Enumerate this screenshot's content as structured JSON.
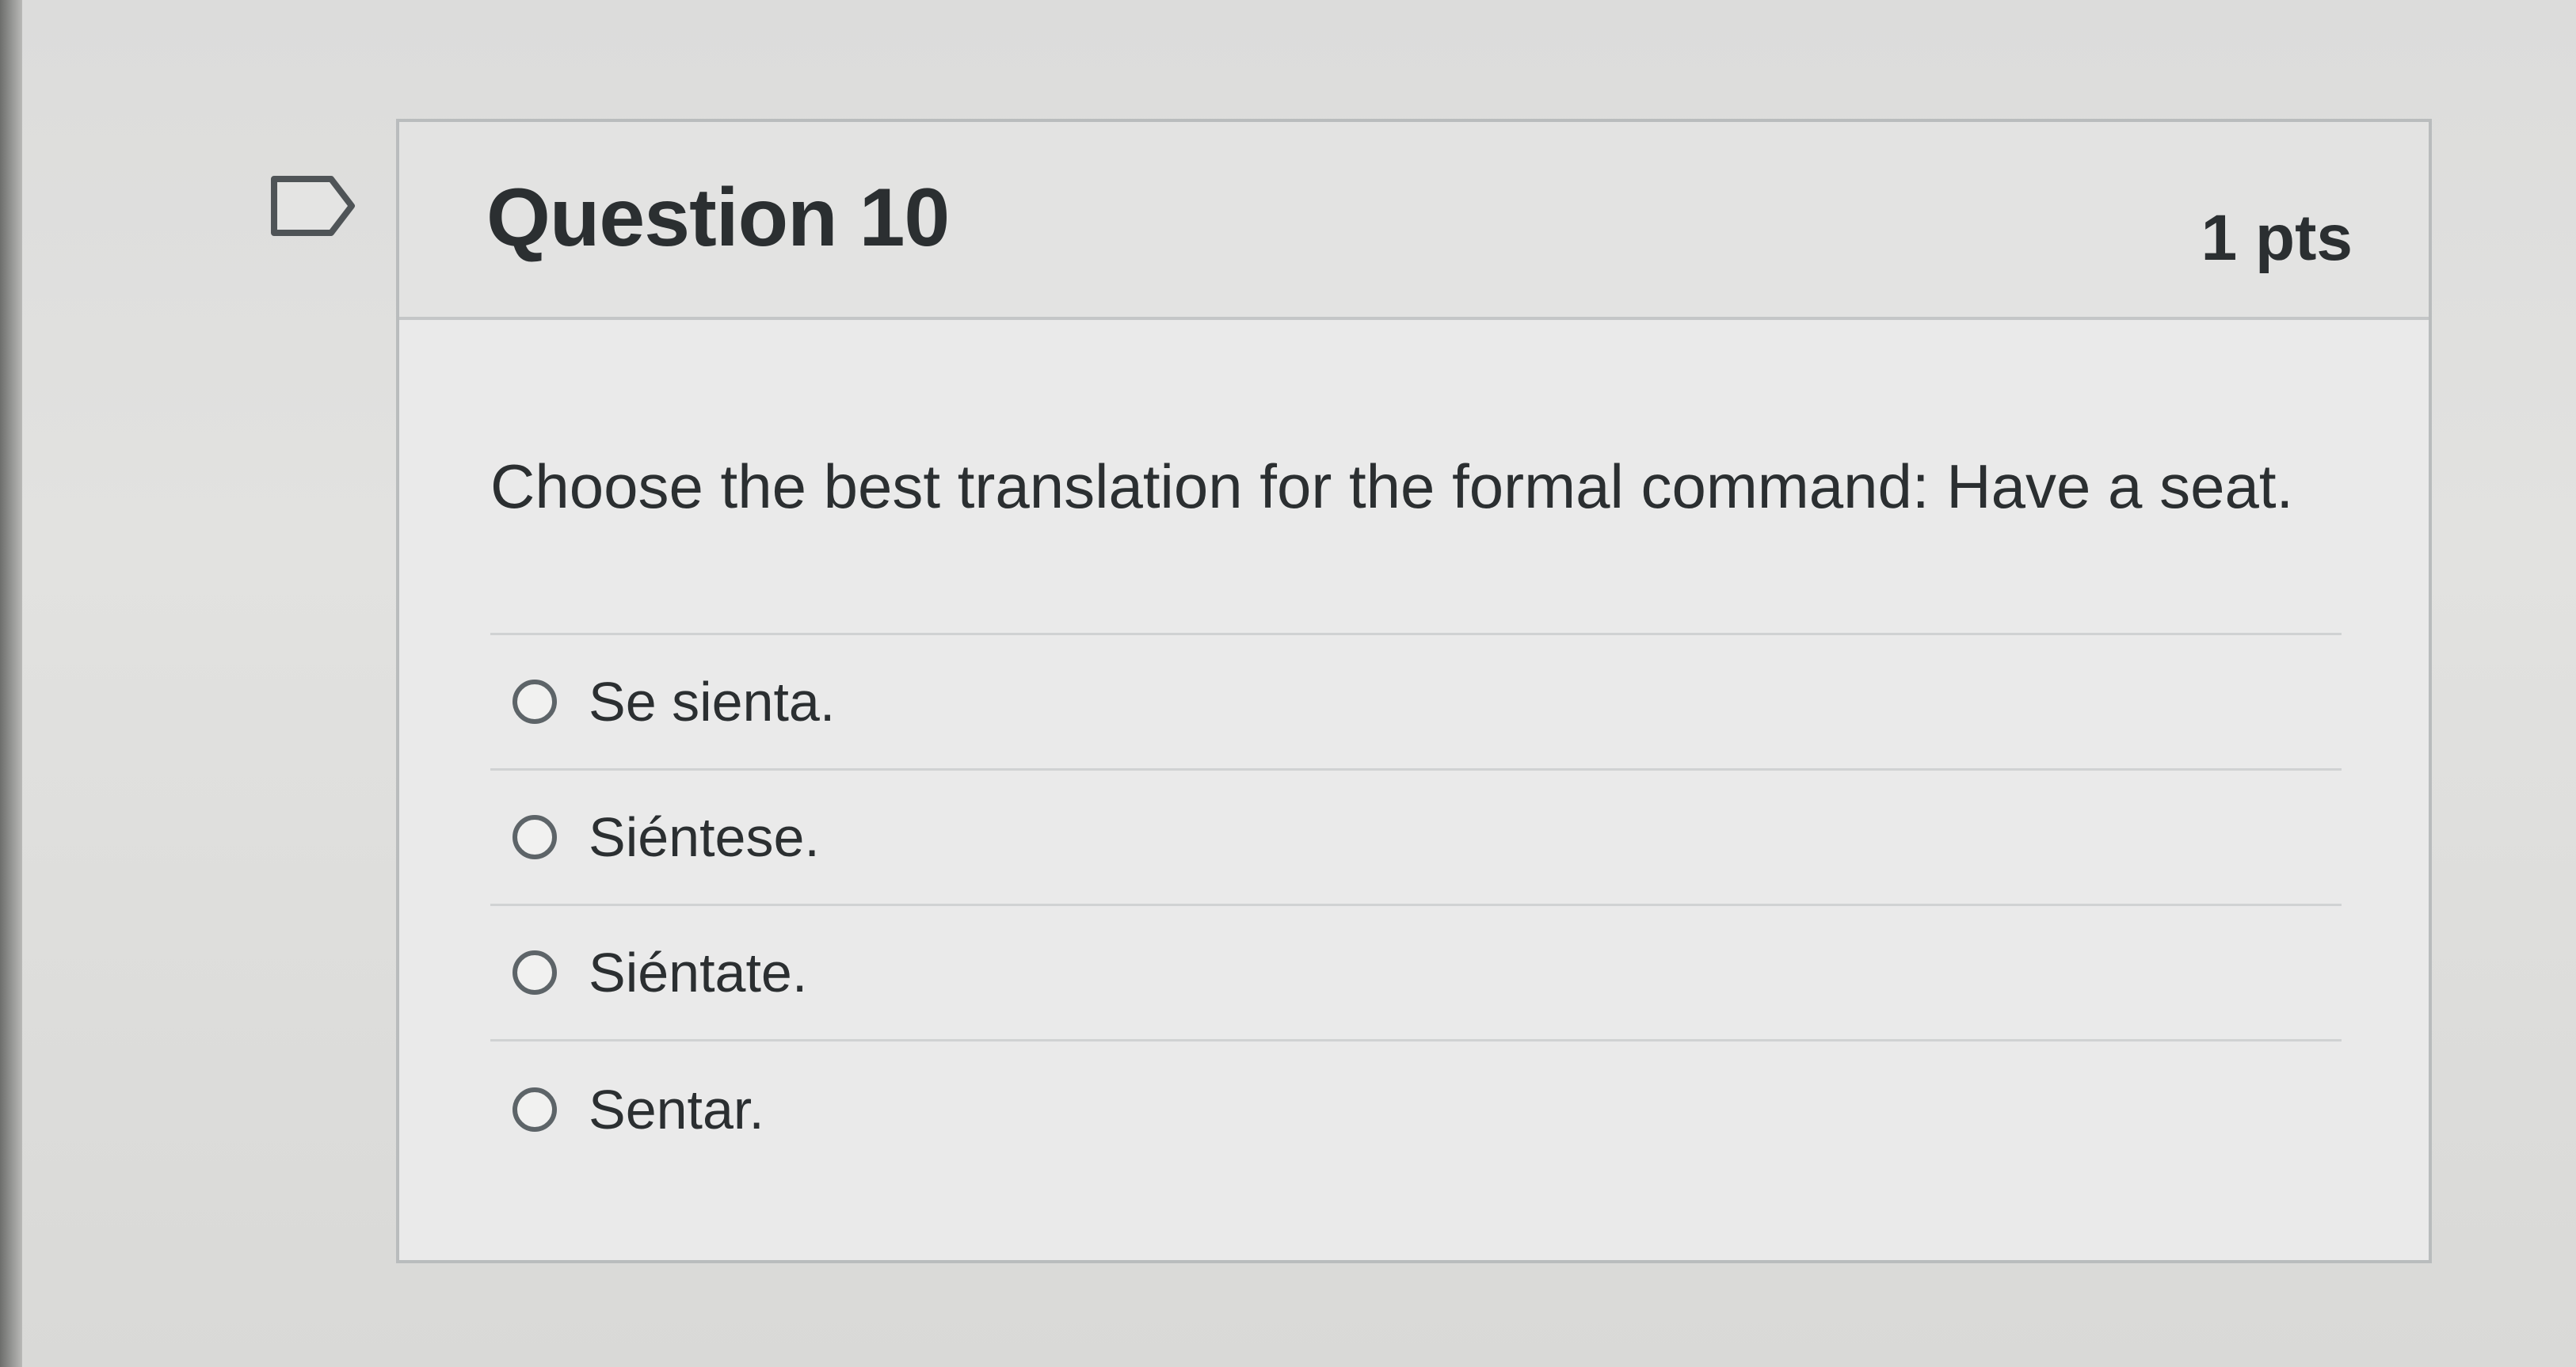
{
  "question": {
    "title": "Question 10",
    "points": "1 pts",
    "text": "Choose the best translation for the formal command: Have a seat.",
    "answers": [
      {
        "label": "Se sienta."
      },
      {
        "label": "Siéntese."
      },
      {
        "label": "Siéntate."
      },
      {
        "label": "Sentar."
      }
    ]
  },
  "icons": {
    "flag": "flag-outline-icon",
    "radio": "radio-unchecked-icon"
  },
  "colors": {
    "text": "#2b2f31",
    "border": "#b9bcbd",
    "header_bg": "#e3e3e2",
    "card_bg": "#eaeaea"
  }
}
